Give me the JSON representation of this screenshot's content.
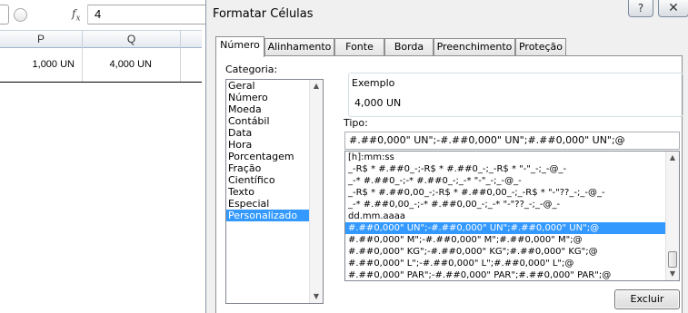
{
  "excel": {
    "formula_value": "4",
    "fx_label": "f",
    "fx_sub": "x",
    "columns": [
      "P",
      "Q"
    ],
    "cells": [
      "1,000 UN",
      "4,000 UN"
    ]
  },
  "dialog": {
    "title": "Formatar Células",
    "help_icon": "?",
    "close_icon": "✕",
    "tabs": [
      "Número",
      "Alinhamento",
      "Fonte",
      "Borda",
      "Preenchimento",
      "Proteção"
    ],
    "active_tab": "Número",
    "category_label": "Categoria:",
    "categories": [
      "Geral",
      "Número",
      "Moeda",
      "Contábil",
      "Data",
      "Hora",
      "Porcentagem",
      "Fração",
      "Científico",
      "Texto",
      "Especial",
      "Personalizado"
    ],
    "selected_category": "Personalizado",
    "example_label": "Exemplo",
    "example_value": "4,000 UN",
    "type_label": "Tipo:",
    "type_value": "#.##0,000\" UN\";-#.##0,000\" UN\";#.##0,000\" UN\";@",
    "formats": [
      "[h]:mm:ss",
      "_-R$ * #.##0_-;-R$ * #.##0_-;_-R$ * \"-\"_-;_-@_-",
      "_-* #.##0_-;-* #.##0_-;_-* \"-\"_-;_-@_-",
      "_-R$ * #.##0,00_-;-R$ * #.##0,00_-;_-R$ * \"-\"??_-;_-@_-",
      "_-* #.##0,00_-;-* #.##0,00_-;_-* \"-\"??_-;_-@_-",
      "dd.mm.aaaa",
      "#.##0,000\" UN\";-#.##0,000\" UN\";#.##0,000\" UN\";@",
      "#.##0,000\" M\";-#.##0,000\" M\";#.##0,000\" M\";@",
      "#.##0,000\" KG\";-#.##0,000\" KG\";#.##0,000\" KG\";@",
      "#.##0,000\" L\";-#.##0,000\" L\";#.##0,000\" L\";@",
      "#.##0,000\" PAR\";-#.##0,000\" PAR\";#.##0,000\" PAR\";@"
    ],
    "selected_format_index": 6,
    "delete_button": "Excluir"
  }
}
